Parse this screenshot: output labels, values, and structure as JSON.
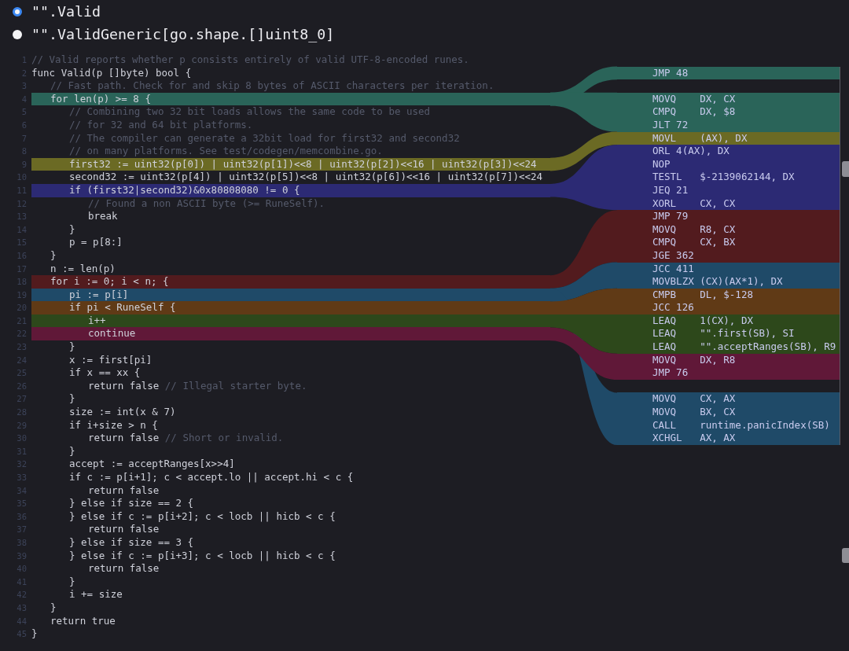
{
  "functions": [
    {
      "name": "\"\".Valid",
      "selected": true
    },
    {
      "name": "\"\".ValidGeneric[go.shape.[]uint8_0]",
      "selected": false
    }
  ],
  "source": {
    "lines": [
      {
        "number": "1",
        "comment": "// Valid reports whether p consists entirely of valid UTF-8-encoded runes."
      },
      {
        "number": "2",
        "code": "func Valid(p []byte) bool {"
      },
      {
        "number": "3",
        "comment": "\t// Fast path. Check for and skip 8 bytes of ASCII characters per iteration."
      },
      {
        "number": "4",
        "code": "\tfor len(p) >= 8 {",
        "color": "#2a6459"
      },
      {
        "number": "5",
        "comment": "\t\t// Combining two 32 bit loads allows the same code to be used"
      },
      {
        "number": "6",
        "comment": "\t\t// for 32 and 64 bit platforms."
      },
      {
        "number": "7",
        "comment": "\t\t// The compiler can generate a 32bit load for first32 and second32"
      },
      {
        "number": "8",
        "comment": "\t\t// on many platforms. See test/codegen/memcombine.go."
      },
      {
        "number": "9",
        "code": "\t\tfirst32 := uint32(p[0]) | uint32(p[1])<<8 | uint32(p[2])<<16 | uint32(p[3])<<24",
        "color": "#6b6a24"
      },
      {
        "number": "10",
        "code": "\t\tsecond32 := uint32(p[4]) | uint32(p[5])<<8 | uint32(p[6])<<16 | uint32(p[7])<<24"
      },
      {
        "number": "11",
        "code": "\t\tif (first32|second32)&0x80808080 != 0 {",
        "color": "#2c2a74"
      },
      {
        "number": "12",
        "comment": "\t\t\t// Found a non ASCII byte (>= RuneSelf)."
      },
      {
        "number": "13",
        "code": "\t\t\tbreak"
      },
      {
        "number": "14",
        "code": "\t\t}"
      },
      {
        "number": "15",
        "code": "\t\tp = p[8:]"
      },
      {
        "number": "16",
        "code": "\t}"
      },
      {
        "number": "17",
        "code": "\tn := len(p)"
      },
      {
        "number": "18",
        "code": "\tfor i := 0; i < n; {",
        "color": "#521b1e"
      },
      {
        "number": "19",
        "code": "\t\tpi := p[i]",
        "color": "#1f4a68"
      },
      {
        "number": "20",
        "code": "\t\tif pi < RuneSelf {",
        "color": "#603a16"
      },
      {
        "number": "21",
        "code": "\t\t\ti++",
        "color": "#2d481b"
      },
      {
        "number": "22",
        "code": "\t\t\tcontinue",
        "color": "#601838"
      },
      {
        "number": "23",
        "code": "\t\t}"
      },
      {
        "number": "24",
        "code": "\t\tx := first[pi]"
      },
      {
        "number": "25",
        "code": "\t\tif x == xx {"
      },
      {
        "number": "26",
        "code": "\t\t\treturn false",
        "comment": "// Illegal starter byte."
      },
      {
        "number": "27",
        "code": "\t\t}"
      },
      {
        "number": "28",
        "code": "\t\tsize := int(x & 7)"
      },
      {
        "number": "29",
        "code": "\t\tif i+size > n {"
      },
      {
        "number": "30",
        "code": "\t\t\treturn false",
        "comment": "// Short or invalid."
      },
      {
        "number": "31",
        "code": "\t\t}"
      },
      {
        "number": "32",
        "code": "\t\taccept := acceptRanges[x>>4]"
      },
      {
        "number": "33",
        "code": "\t\tif c := p[i+1]; c < accept.lo || accept.hi < c {"
      },
      {
        "number": "34",
        "code": "\t\t\treturn false"
      },
      {
        "number": "35",
        "code": "\t\t} else if size == 2 {"
      },
      {
        "number": "36",
        "code": "\t\t} else if c := p[i+2]; c < locb || hicb < c {"
      },
      {
        "number": "37",
        "code": "\t\t\treturn false"
      },
      {
        "number": "38",
        "code": "\t\t} else if size == 3 {"
      },
      {
        "number": "39",
        "code": "\t\t} else if c := p[i+3]; c < locb || hicb < c {"
      },
      {
        "number": "40",
        "code": "\t\t\treturn false"
      },
      {
        "number": "41",
        "code": "\t\t}"
      },
      {
        "number": "42",
        "code": "\t\ti += size"
      },
      {
        "number": "43",
        "code": "\t}"
      },
      {
        "number": "44",
        "code": "\treturn true"
      },
      {
        "number": "45",
        "code": "}"
      }
    ]
  },
  "assembly": {
    "blocks": [
      {
        "rows": [
          {
            "text": "JMP 48",
            "color": "#2a6459"
          }
        ]
      },
      {
        "rows": [
          {
            "text": "MOVQ    DX, CX",
            "color": "#2a6459"
          },
          {
            "text": "CMPQ    DX, $8",
            "color": "#2a6459"
          },
          {
            "text": "JLT 72",
            "color": "#2a6459"
          },
          {
            "text": "MOVL    (AX), DX",
            "color": "#6b6a24"
          },
          {
            "text": "ORL 4(AX), DX",
            "color": "#2c2a74"
          },
          {
            "text": "NOP",
            "color": "#2c2a74"
          },
          {
            "text": "TESTL   $-2139062144, DX",
            "color": "#2c2a74"
          },
          {
            "text": "JEQ 21",
            "color": "#2c2a74"
          },
          {
            "text": "XORL    CX, CX",
            "color": "#2c2a74"
          },
          {
            "text": "JMP 79",
            "color": "#521b1e"
          },
          {
            "text": "MOVQ    R8, CX",
            "color": "#521b1e"
          },
          {
            "text": "CMPQ    CX, BX",
            "color": "#521b1e"
          },
          {
            "text": "JGE 362",
            "color": "#521b1e"
          },
          {
            "text": "JCC 411",
            "color": "#1f4a68"
          },
          {
            "text": "MOVBLZX (CX)(AX*1), DX",
            "color": "#1f4a68"
          },
          {
            "text": "CMPB    DL, $-128",
            "color": "#603a16"
          },
          {
            "text": "JCC 126",
            "color": "#603a16"
          },
          {
            "text": "LEAQ    1(CX), DX",
            "color": "#2d481b"
          },
          {
            "text": "LEAQ    \"\".first(SB), SI",
            "color": "#2d481b"
          },
          {
            "text": "LEAQ    \"\".acceptRanges(SB), R9",
            "color": "#2d481b"
          },
          {
            "text": "MOVQ    DX, R8",
            "color": "#601838"
          },
          {
            "text": "JMP 76",
            "color": "#601838"
          }
        ]
      },
      {
        "rows": [
          {
            "text": "MOVQ    CX, AX",
            "color": "#1f4a68"
          },
          {
            "text": "MOVQ    BX, CX",
            "color": "#1f4a68"
          },
          {
            "text": "CALL    runtime.panicIndex(SB)",
            "color": "#1f4a68"
          },
          {
            "text": "XCHGL   AX, AX",
            "color": "#1f4a68"
          }
        ]
      }
    ]
  }
}
